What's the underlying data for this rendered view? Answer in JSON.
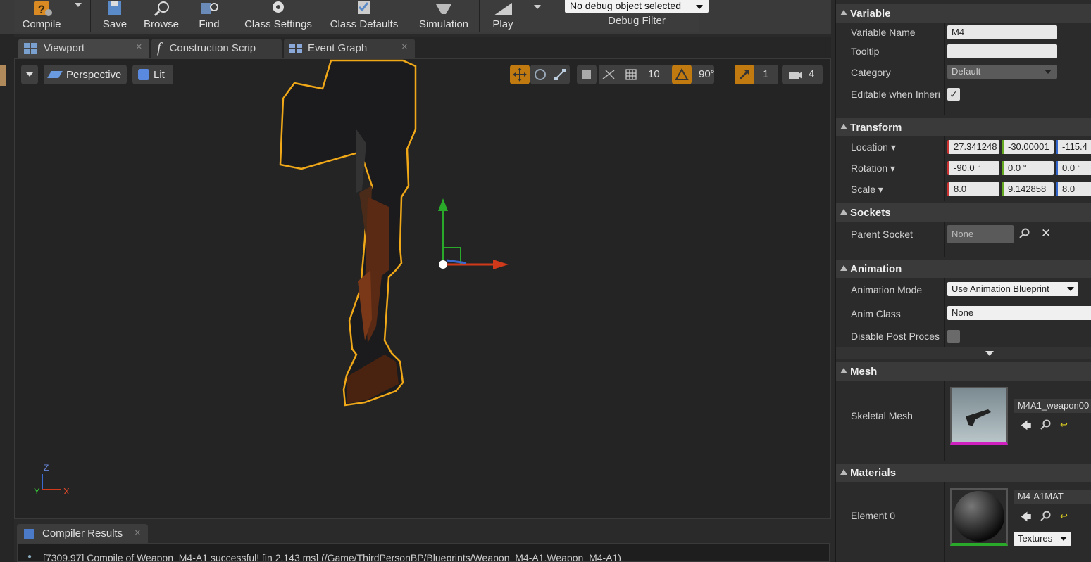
{
  "toolbar": {
    "compile": "Compile",
    "save": "Save",
    "browse": "Browse",
    "find": "Find",
    "class_settings": "Class Settings",
    "class_defaults": "Class Defaults",
    "simulation": "Simulation",
    "play": "Play",
    "debug_select": "No debug object selected",
    "debug_filter": "Debug Filter"
  },
  "tabs": [
    {
      "label": "Viewport"
    },
    {
      "label": "Construction Scrip"
    },
    {
      "label": "Event Graph"
    }
  ],
  "viewport": {
    "perspective": "Perspective",
    "lit": "Lit",
    "grid_snap": "10",
    "rotation_snap": "90°",
    "scale_snap": "1",
    "camera_speed": "4",
    "axis_x": "X",
    "axis_y": "Y",
    "axis_z": "Z"
  },
  "compiler": {
    "tab": "Compiler Results",
    "message": "[7309.97] Compile of Weapon_M4-A1 successful! [in 2,143 ms] (/Game/ThirdPersonBP/Blueprints/Weapon_M4-A1.Weapon_M4-A1)"
  },
  "details": {
    "variable": {
      "header": "Variable",
      "name_label": "Variable Name",
      "name_value": "M4",
      "tooltip_label": "Tooltip",
      "tooltip_value": "",
      "category_label": "Category",
      "category_value": "Default",
      "editable_label": "Editable when Inheri"
    },
    "transform": {
      "header": "Transform",
      "location_label": "Location",
      "location": [
        "27.341248",
        "-30.00001",
        "-115.4"
      ],
      "rotation_label": "Rotation",
      "rotation": [
        "-90.0 °",
        "0.0 °",
        "0.0 °"
      ],
      "scale_label": "Scale",
      "scale": [
        "8.0",
        "9.142858",
        "8.0"
      ]
    },
    "sockets": {
      "header": "Sockets",
      "parent_label": "Parent Socket",
      "parent_value": "None"
    },
    "animation": {
      "header": "Animation",
      "mode_label": "Animation Mode",
      "mode_value": "Use Animation Blueprint",
      "class_label": "Anim Class",
      "class_value": "None",
      "disable_label": "Disable Post Proces"
    },
    "mesh": {
      "header": "Mesh",
      "skeletal_label": "Skeletal Mesh",
      "skeletal_value": "M4A1_weapon00"
    },
    "materials": {
      "header": "Materials",
      "element_label": "Element 0",
      "element_value": "M4-A1MAT",
      "textures": "Textures"
    }
  },
  "colors": {
    "accent_orange": "#c07a0f",
    "selection_outline": "#f0a818",
    "axis_x": "#d03a1a",
    "axis_y": "#2aa82a",
    "axis_z": "#3a6ad0"
  }
}
